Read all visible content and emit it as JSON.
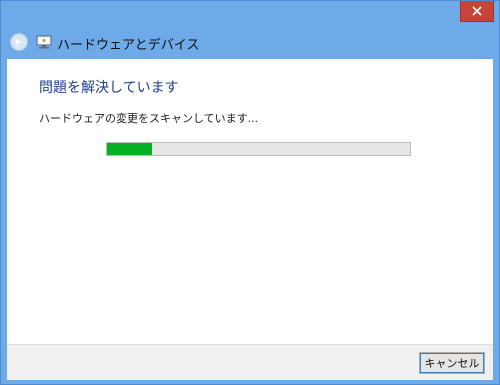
{
  "window": {
    "close_icon": "close-icon"
  },
  "nav": {
    "back_icon": "back-arrow-icon",
    "app_icon": "hardware-devices-icon",
    "title": "ハードウェアとデバイス"
  },
  "main": {
    "heading": "問題を解決しています",
    "status": "ハードウェアの変更をスキャンしています...",
    "progress_fraction": 0.15
  },
  "footer": {
    "cancel_label": "キャンセル"
  },
  "colors": {
    "title_bar": "#6ea9e8",
    "heading": "#1e3d8f",
    "progress_fill": "#06b025",
    "close_button": "#c9433a"
  }
}
